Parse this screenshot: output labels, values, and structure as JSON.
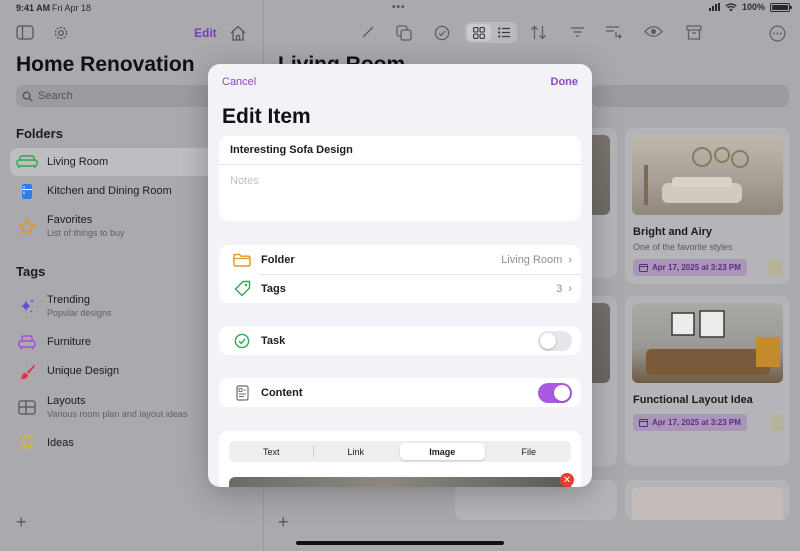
{
  "status": {
    "time": "9:41 AM",
    "date": "Fri Apr 18",
    "battery": "100%"
  },
  "sidebar": {
    "edit_label": "Edit",
    "title": "Home Renovation",
    "search_placeholder": "Search",
    "folders_heading": "Folders",
    "folders": [
      {
        "label": "Living Room",
        "icon": "sofa-icon"
      },
      {
        "label": "Kitchen and Dining Room",
        "icon": "fridge-icon"
      },
      {
        "label": "Favorites",
        "subtitle": "List of things to buy",
        "icon": "star-icon"
      }
    ],
    "tags_heading": "Tags",
    "tags": [
      {
        "label": "Trending",
        "subtitle": "Popular designs",
        "icon": "sparkles-icon"
      },
      {
        "label": "Furniture",
        "icon": "armchair-icon"
      },
      {
        "label": "Unique Design",
        "icon": "paintbrush-icon"
      },
      {
        "label": "Layouts",
        "subtitle": "Various room plan and layout ideas",
        "icon": "layout-grid-icon"
      },
      {
        "label": "Ideas",
        "icon": "lightbulb-icon"
      }
    ]
  },
  "main": {
    "title": "Living Room",
    "cards": [
      {
        "title": "Bright and Airy",
        "subtitle": "One of the favorite styles",
        "date": "Apr 17, 2025 at 3:23 PM"
      },
      {
        "title": "Functional Layout Idea",
        "date": "Apr 17, 2025 at 3:23 PM"
      }
    ]
  },
  "modal": {
    "cancel_label": "Cancel",
    "done_label": "Done",
    "title": "Edit Item",
    "name_value": "Interesting Sofa Design",
    "notes_placeholder": "Notes",
    "folder_label": "Folder",
    "folder_value": "Living Room",
    "tags_label": "Tags",
    "tags_value": "3",
    "task_label": "Task",
    "task_on": false,
    "content_label": "Content",
    "content_on": true,
    "content_tabs": [
      "Text",
      "Link",
      "Image",
      "File"
    ],
    "selected_tab": "Image"
  },
  "colors": {
    "accent": "#8e44c8",
    "toggle_on": "#a95be0",
    "chip_text": "#5a2d85",
    "remove": "#f03a2e"
  }
}
